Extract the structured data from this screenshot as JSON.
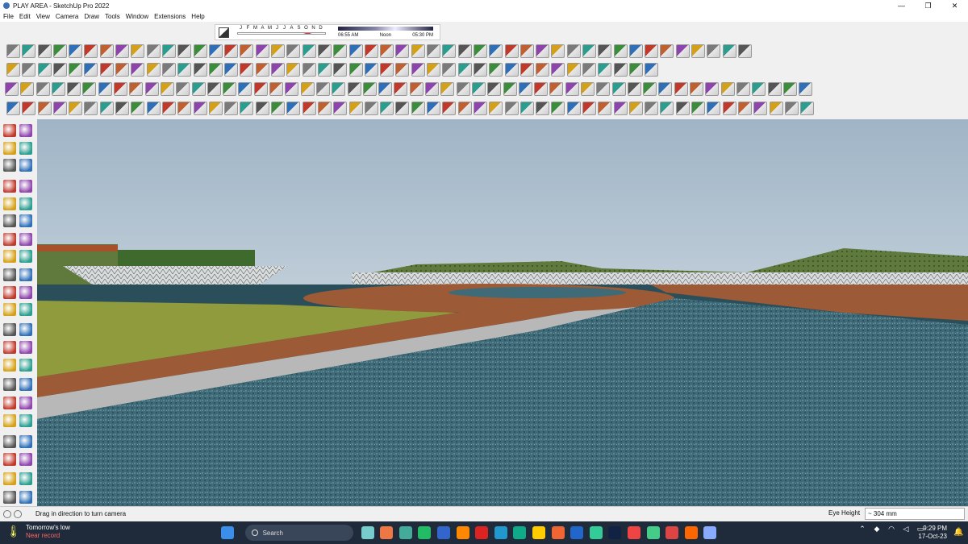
{
  "window": {
    "title": "PLAY AREA - SketchUp Pro 2022",
    "min_glyph": "—",
    "max_glyph": "❐",
    "close_glyph": "✕"
  },
  "menu": [
    "File",
    "Edit",
    "View",
    "Camera",
    "Draw",
    "Tools",
    "Window",
    "Extensions",
    "Help"
  ],
  "shadows": {
    "months": [
      "J",
      "F",
      "M",
      "A",
      "M",
      "J",
      "J",
      "A",
      "S",
      "O",
      "N",
      "D"
    ],
    "time_start": "06:55 AM",
    "time_mid": "Noon",
    "time_end": "05:30 PM"
  },
  "status": {
    "message": "Drag in direction to turn camera",
    "eye_height_label": "Eye Height",
    "eye_height_value": "~ 304 mm"
  },
  "taskbar": {
    "weather_title": "Tomorrow's low",
    "weather_sub": "Near record",
    "search_placeholder": "Search",
    "time": "9:29 PM",
    "date": "17-Oct-23"
  },
  "colors": {
    "sky_top": "#9fb4c6",
    "sky_bottom": "#e6ecef",
    "water": "#3e6b77",
    "lawn": "#8f9b3c",
    "path": "#9c5a36",
    "hills": "#5f7a3c",
    "taskbar": "#1f2a3a"
  }
}
